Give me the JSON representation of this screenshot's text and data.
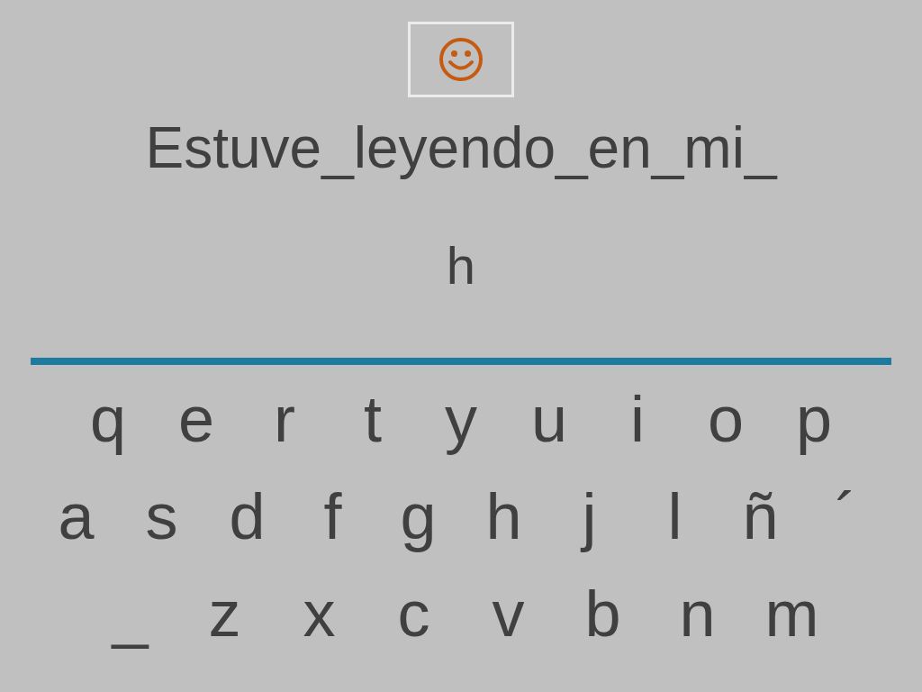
{
  "sentence": "Estuve_leyendo_en_mi_",
  "answer": "h",
  "keyboard": {
    "rows": [
      [
        "q",
        "e",
        "r",
        "t",
        "y",
        "u",
        "i",
        "o",
        "p"
      ],
      [
        "a",
        "s",
        "d",
        "f",
        "g",
        "h",
        "j",
        "l",
        "ñ",
        "´"
      ],
      [
        "_",
        "z",
        "x",
        "c",
        "v",
        "b",
        "n",
        "m"
      ]
    ]
  }
}
